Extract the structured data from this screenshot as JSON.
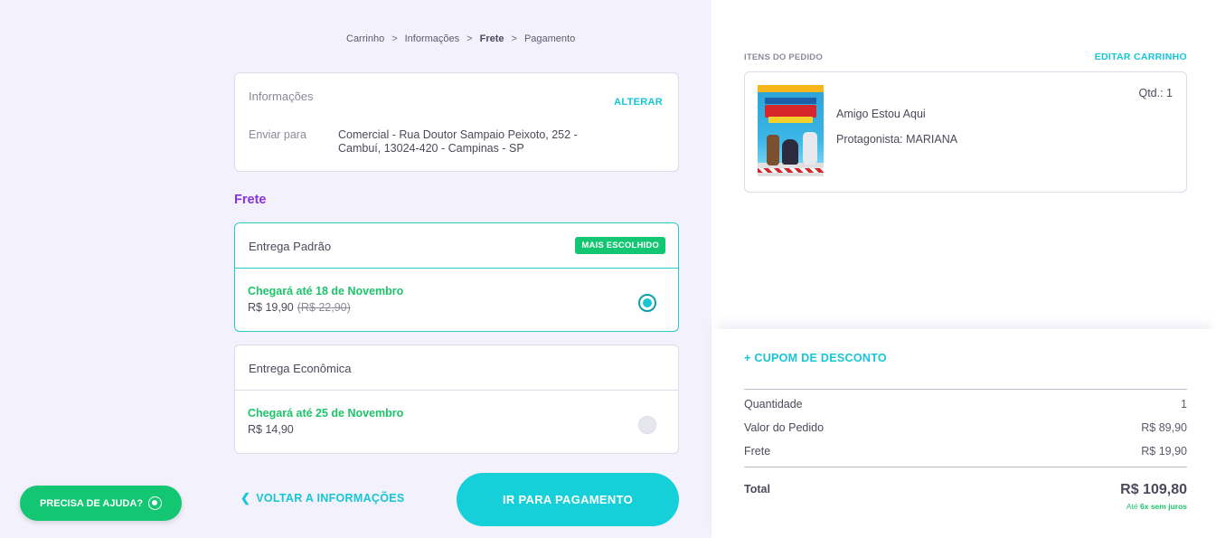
{
  "breadcrumb": {
    "items": [
      "Carrinho",
      "Informações",
      "Frete",
      "Pagamento"
    ],
    "separator": ">",
    "active_index": 2
  },
  "info_card": {
    "title": "Informações",
    "alter_label": "ALTERAR",
    "ship_to_label": "Enviar para",
    "address": "Comercial - Rua Doutor Sampaio Peixoto, 252 - Cambuí, 13024-420 - Campinas - SP"
  },
  "frete": {
    "heading": "Frete",
    "options": [
      {
        "name": "Entrega Padrão",
        "badge": "MAIS ESCOLHIDO",
        "arrival": "Chegará até 18 de Novembro",
        "price": "R$ 19,90",
        "old_price": "(R$ 22,90)",
        "selected": true
      },
      {
        "name": "Entrega Econômica",
        "arrival": "Chegará até 25 de Novembro",
        "price": "R$ 14,90",
        "selected": false
      }
    ]
  },
  "actions": {
    "back_label": "VOLTAR A INFORMAÇÕES",
    "next_label": "IR PARA PAGAMENTO"
  },
  "help": {
    "label": "PRECISA DE AJUDA?",
    "icon": "whatsapp-icon"
  },
  "order": {
    "items_label": "ITENS DO PEDIDO",
    "edit_label": "EDITAR CARRINHO",
    "item": {
      "title": "Amigo Estou Aqui",
      "subtitle": "Protagonista: MARIANA",
      "quantity": "Qtd.: 1"
    }
  },
  "summary": {
    "coupon_label": "+ CUPOM DE DESCONTO",
    "rows": [
      {
        "label": "Quantidade",
        "value": "1"
      },
      {
        "label": "Valor do Pedido",
        "value": "R$ 89,90"
      },
      {
        "label": "Frete",
        "value": "R$ 19,90"
      }
    ],
    "total_label": "Total",
    "total_value": "R$ 109,80",
    "installments_prefix": "Até",
    "installments_highlight": "6x sem juros"
  },
  "colors": {
    "accent": "#16c6d6",
    "green": "#13c672",
    "purple": "#8a33d8",
    "page_bg": "#f3f1fb"
  }
}
